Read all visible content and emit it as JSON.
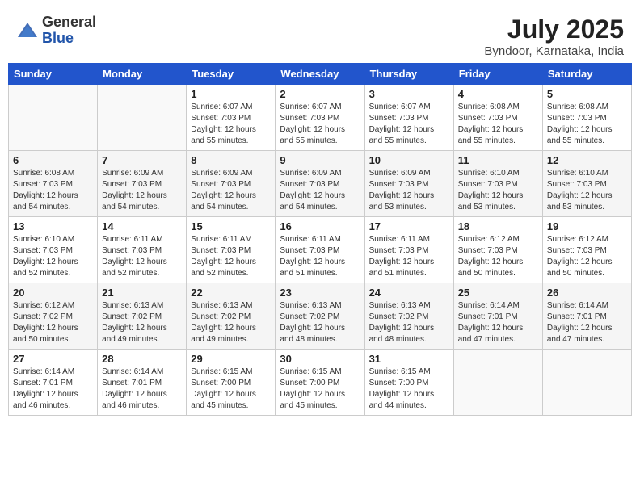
{
  "header": {
    "logo_general": "General",
    "logo_blue": "Blue",
    "month_year": "July 2025",
    "location": "Byndoor, Karnataka, India"
  },
  "days_of_week": [
    "Sunday",
    "Monday",
    "Tuesday",
    "Wednesday",
    "Thursday",
    "Friday",
    "Saturday"
  ],
  "weeks": [
    [
      {
        "day": "",
        "info": ""
      },
      {
        "day": "",
        "info": ""
      },
      {
        "day": "1",
        "info": "Sunrise: 6:07 AM\nSunset: 7:03 PM\nDaylight: 12 hours and 55 minutes."
      },
      {
        "day": "2",
        "info": "Sunrise: 6:07 AM\nSunset: 7:03 PM\nDaylight: 12 hours and 55 minutes."
      },
      {
        "day": "3",
        "info": "Sunrise: 6:07 AM\nSunset: 7:03 PM\nDaylight: 12 hours and 55 minutes."
      },
      {
        "day": "4",
        "info": "Sunrise: 6:08 AM\nSunset: 7:03 PM\nDaylight: 12 hours and 55 minutes."
      },
      {
        "day": "5",
        "info": "Sunrise: 6:08 AM\nSunset: 7:03 PM\nDaylight: 12 hours and 55 minutes."
      }
    ],
    [
      {
        "day": "6",
        "info": "Sunrise: 6:08 AM\nSunset: 7:03 PM\nDaylight: 12 hours and 54 minutes."
      },
      {
        "day": "7",
        "info": "Sunrise: 6:09 AM\nSunset: 7:03 PM\nDaylight: 12 hours and 54 minutes."
      },
      {
        "day": "8",
        "info": "Sunrise: 6:09 AM\nSunset: 7:03 PM\nDaylight: 12 hours and 54 minutes."
      },
      {
        "day": "9",
        "info": "Sunrise: 6:09 AM\nSunset: 7:03 PM\nDaylight: 12 hours and 54 minutes."
      },
      {
        "day": "10",
        "info": "Sunrise: 6:09 AM\nSunset: 7:03 PM\nDaylight: 12 hours and 53 minutes."
      },
      {
        "day": "11",
        "info": "Sunrise: 6:10 AM\nSunset: 7:03 PM\nDaylight: 12 hours and 53 minutes."
      },
      {
        "day": "12",
        "info": "Sunrise: 6:10 AM\nSunset: 7:03 PM\nDaylight: 12 hours and 53 minutes."
      }
    ],
    [
      {
        "day": "13",
        "info": "Sunrise: 6:10 AM\nSunset: 7:03 PM\nDaylight: 12 hours and 52 minutes."
      },
      {
        "day": "14",
        "info": "Sunrise: 6:11 AM\nSunset: 7:03 PM\nDaylight: 12 hours and 52 minutes."
      },
      {
        "day": "15",
        "info": "Sunrise: 6:11 AM\nSunset: 7:03 PM\nDaylight: 12 hours and 52 minutes."
      },
      {
        "day": "16",
        "info": "Sunrise: 6:11 AM\nSunset: 7:03 PM\nDaylight: 12 hours and 51 minutes."
      },
      {
        "day": "17",
        "info": "Sunrise: 6:11 AM\nSunset: 7:03 PM\nDaylight: 12 hours and 51 minutes."
      },
      {
        "day": "18",
        "info": "Sunrise: 6:12 AM\nSunset: 7:03 PM\nDaylight: 12 hours and 50 minutes."
      },
      {
        "day": "19",
        "info": "Sunrise: 6:12 AM\nSunset: 7:03 PM\nDaylight: 12 hours and 50 minutes."
      }
    ],
    [
      {
        "day": "20",
        "info": "Sunrise: 6:12 AM\nSunset: 7:02 PM\nDaylight: 12 hours and 50 minutes."
      },
      {
        "day": "21",
        "info": "Sunrise: 6:13 AM\nSunset: 7:02 PM\nDaylight: 12 hours and 49 minutes."
      },
      {
        "day": "22",
        "info": "Sunrise: 6:13 AM\nSunset: 7:02 PM\nDaylight: 12 hours and 49 minutes."
      },
      {
        "day": "23",
        "info": "Sunrise: 6:13 AM\nSunset: 7:02 PM\nDaylight: 12 hours and 48 minutes."
      },
      {
        "day": "24",
        "info": "Sunrise: 6:13 AM\nSunset: 7:02 PM\nDaylight: 12 hours and 48 minutes."
      },
      {
        "day": "25",
        "info": "Sunrise: 6:14 AM\nSunset: 7:01 PM\nDaylight: 12 hours and 47 minutes."
      },
      {
        "day": "26",
        "info": "Sunrise: 6:14 AM\nSunset: 7:01 PM\nDaylight: 12 hours and 47 minutes."
      }
    ],
    [
      {
        "day": "27",
        "info": "Sunrise: 6:14 AM\nSunset: 7:01 PM\nDaylight: 12 hours and 46 minutes."
      },
      {
        "day": "28",
        "info": "Sunrise: 6:14 AM\nSunset: 7:01 PM\nDaylight: 12 hours and 46 minutes."
      },
      {
        "day": "29",
        "info": "Sunrise: 6:15 AM\nSunset: 7:00 PM\nDaylight: 12 hours and 45 minutes."
      },
      {
        "day": "30",
        "info": "Sunrise: 6:15 AM\nSunset: 7:00 PM\nDaylight: 12 hours and 45 minutes."
      },
      {
        "day": "31",
        "info": "Sunrise: 6:15 AM\nSunset: 7:00 PM\nDaylight: 12 hours and 44 minutes."
      },
      {
        "day": "",
        "info": ""
      },
      {
        "day": "",
        "info": ""
      }
    ]
  ]
}
